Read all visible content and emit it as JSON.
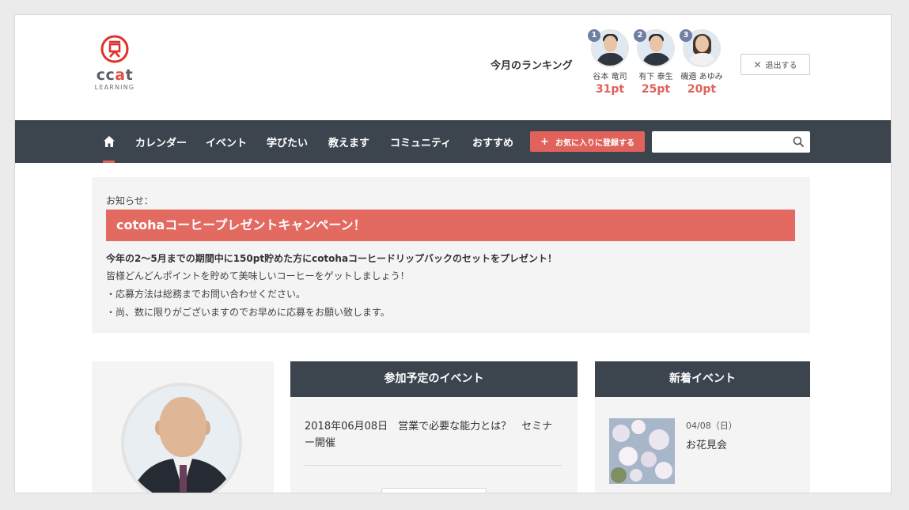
{
  "logo": {
    "brand": "ccat",
    "brand_main": "cc",
    "brand_accent": "a",
    "brand_end": "t",
    "sub": "LEARNING"
  },
  "ranking": {
    "label": "今月のランキング",
    "entries": [
      {
        "rank": "1",
        "name": "谷本 竜司",
        "points": "31pt"
      },
      {
        "rank": "2",
        "name": "有下 泰生",
        "points": "25pt"
      },
      {
        "rank": "3",
        "name": "磯邉 あゆみ",
        "points": "20pt"
      }
    ]
  },
  "header": {
    "logout_label": "退出する"
  },
  "nav": {
    "items": [
      "カレンダー",
      "イベント",
      "学びたい",
      "教えます",
      "コミュニティ",
      "おすすめ"
    ],
    "favorite_label": "お気に入りに登録する",
    "search_placeholder": ""
  },
  "notice": {
    "label": "お知らせ：",
    "banner": "cotohaコーヒープレゼントキャンペーン！",
    "lead": "今年の2〜5月までの期間中に150pt貯めた方にcotohaコーヒードリップバックのセットをプレゼント！",
    "lines": [
      "皆様どんどんポイントを貯めて美味しいコーヒーをゲットしましょう！",
      "・応募方法は総務までお問い合わせください。",
      "・尚、数に限りがございますのでお早めに応募をお願い致します。"
    ]
  },
  "upcoming": {
    "title": "参加予定のイベント",
    "item": "2018年06月08日　営業で必要な能力とは？　セミナー開催"
  },
  "new_events": {
    "title": "新着イベント",
    "date": "04/08（日）",
    "name": "お花見会"
  },
  "colors": {
    "accent": "#e0625a",
    "nav_bg": "#3c454e",
    "panel_bg": "#f4f4f4"
  }
}
